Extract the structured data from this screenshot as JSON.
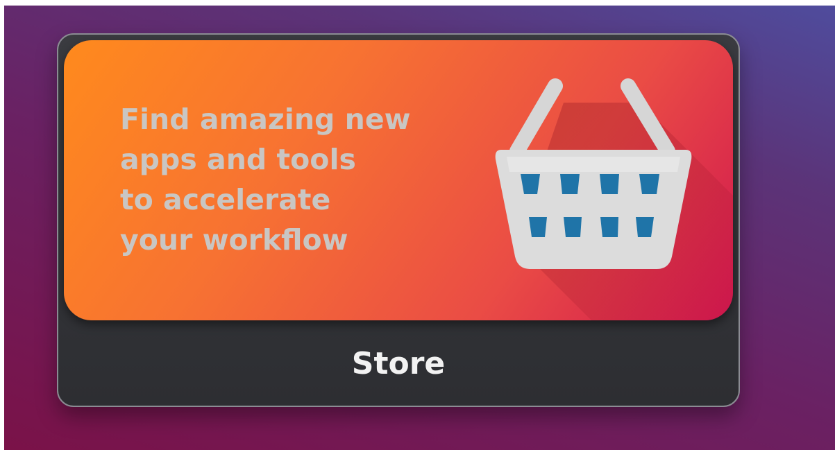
{
  "tile": {
    "headline_lines": [
      "Find amazing new",
      "apps and tools",
      "to accelerate",
      "your workflow"
    ],
    "label": "Store",
    "icon": "shopping-basket-icon"
  },
  "colors": {
    "banner_gradient_start": "#ff8a1d",
    "banner_gradient_end": "#d0164f",
    "headline_text": "#c9c6c3",
    "label_text": "#f2f2f2",
    "card_background": "#2d2e32",
    "basket_body": "#dcdcdc",
    "basket_slots": "#1f74a8"
  }
}
